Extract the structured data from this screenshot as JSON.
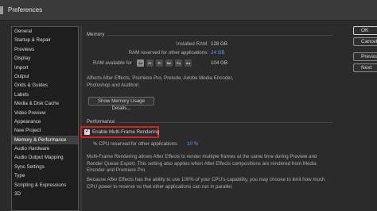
{
  "window": {
    "title": "Preferences"
  },
  "sidebar": {
    "items": [
      {
        "label": "General",
        "active": false
      },
      {
        "label": "Startup & Repair",
        "active": false
      },
      {
        "label": "Previews",
        "active": false
      },
      {
        "label": "Display",
        "active": false
      },
      {
        "label": "Import",
        "active": false
      },
      {
        "label": "Output",
        "active": false
      },
      {
        "label": "Grids & Guides",
        "active": false
      },
      {
        "label": "Labels",
        "active": false
      },
      {
        "label": "Media & Disk Cache",
        "active": false
      },
      {
        "label": "Video Preview",
        "active": false
      },
      {
        "label": "Appearance",
        "active": false
      },
      {
        "label": "New Project",
        "active": false
      },
      {
        "label": "Memory & Performance",
        "active": true
      },
      {
        "label": "Audio Hardware",
        "active": false
      },
      {
        "label": "Audio Output Mapping",
        "active": false
      },
      {
        "label": "Sync Settings",
        "active": false
      },
      {
        "label": "Type",
        "active": false
      },
      {
        "label": "Scripting & Expressions",
        "active": false
      },
      {
        "label": "3D",
        "active": false
      }
    ]
  },
  "memory": {
    "group_label": "Memory",
    "installed_label": "Installed RAM:",
    "installed_value": "128 GB",
    "reserved_label": "RAM reserved for other applications:",
    "reserved_value": "24 GB",
    "available_label": "RAM available for",
    "available_value": "104 GB",
    "apps": [
      "Ae",
      "Pr",
      "Pl",
      "Me",
      "Ps",
      "Au"
    ],
    "description": "Affects After Effects, Premiere Pro, Prelude, Adobe Media Encoder, Photoshop and Audition.",
    "show_details_button": "Show Memory Usage Details..."
  },
  "performance": {
    "group_label": "Performance",
    "mfr_checkbox_label": "Enable Multi-Frame Rendering",
    "mfr_checked": true,
    "cpu_label": "% CPU reserved for other applications:",
    "cpu_value": "10 %",
    "para1": "Multi-Frame Rendering allows After Effects to render multiple frames at the same time during Preview and Render Queue Export. This setting also applies when After Effects compositions are rendered from Media Encoder and Premiere Pro.",
    "para2": "Because After Effects has the ability to use 100% of your CPU's capability, you may choose to limit how much CPU power to reserve so that other applications can run in parallel."
  },
  "buttons": {
    "ok": "OK",
    "cancel": "Cancel",
    "previous": "Previous",
    "next": "Next"
  }
}
